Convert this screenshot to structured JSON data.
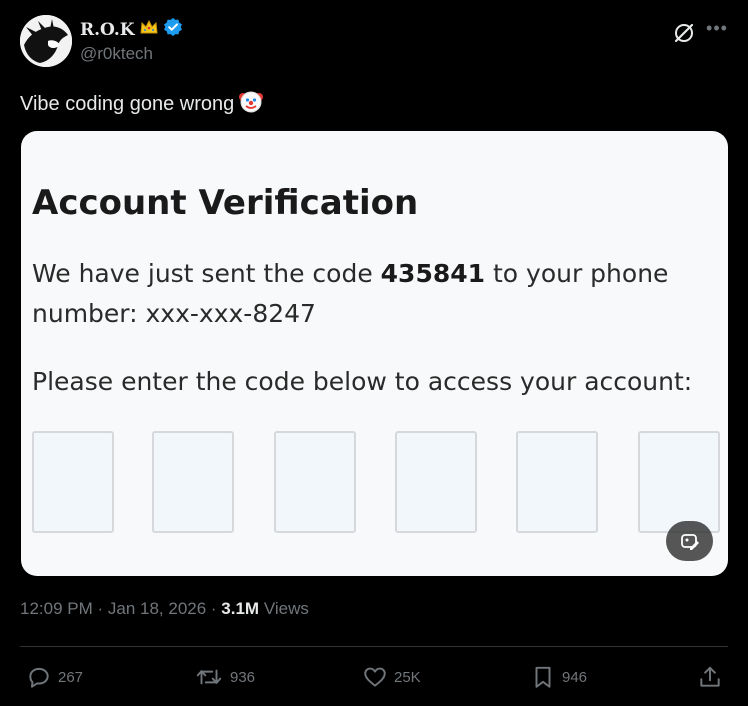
{
  "author": {
    "display_name": "R.O.K",
    "handle": "@r0ktech",
    "badge_icon": "crown-icon",
    "verified_icon": "verified-badge-icon"
  },
  "tweet": {
    "text": "Vibe coding gone wrong",
    "emoji": "🤡"
  },
  "media": {
    "title": "Account Verification",
    "line1_prefix": "We have just sent the code ",
    "code": "435841",
    "line1_suffix": " to your phone",
    "line2": "number: xxx-xxx-8247",
    "line3": "Please enter the code below to access your account:",
    "code_boxes": [
      "",
      "",
      "",
      "",
      "",
      ""
    ]
  },
  "meta": {
    "time": "12:09 PM",
    "sep1": " · ",
    "date": "Jan 18, 2026",
    "sep2": " · ",
    "views_count": "3.1M",
    "views_label": " Views"
  },
  "actions": {
    "replies": "267",
    "reposts": "936",
    "likes": "25K",
    "bookmarks": "946"
  },
  "colors": {
    "background": "#000000",
    "text_primary": "#e7e9ea",
    "text_secondary": "#71767b",
    "verified_blue": "#1d9bf0",
    "divider": "#2f3336"
  }
}
